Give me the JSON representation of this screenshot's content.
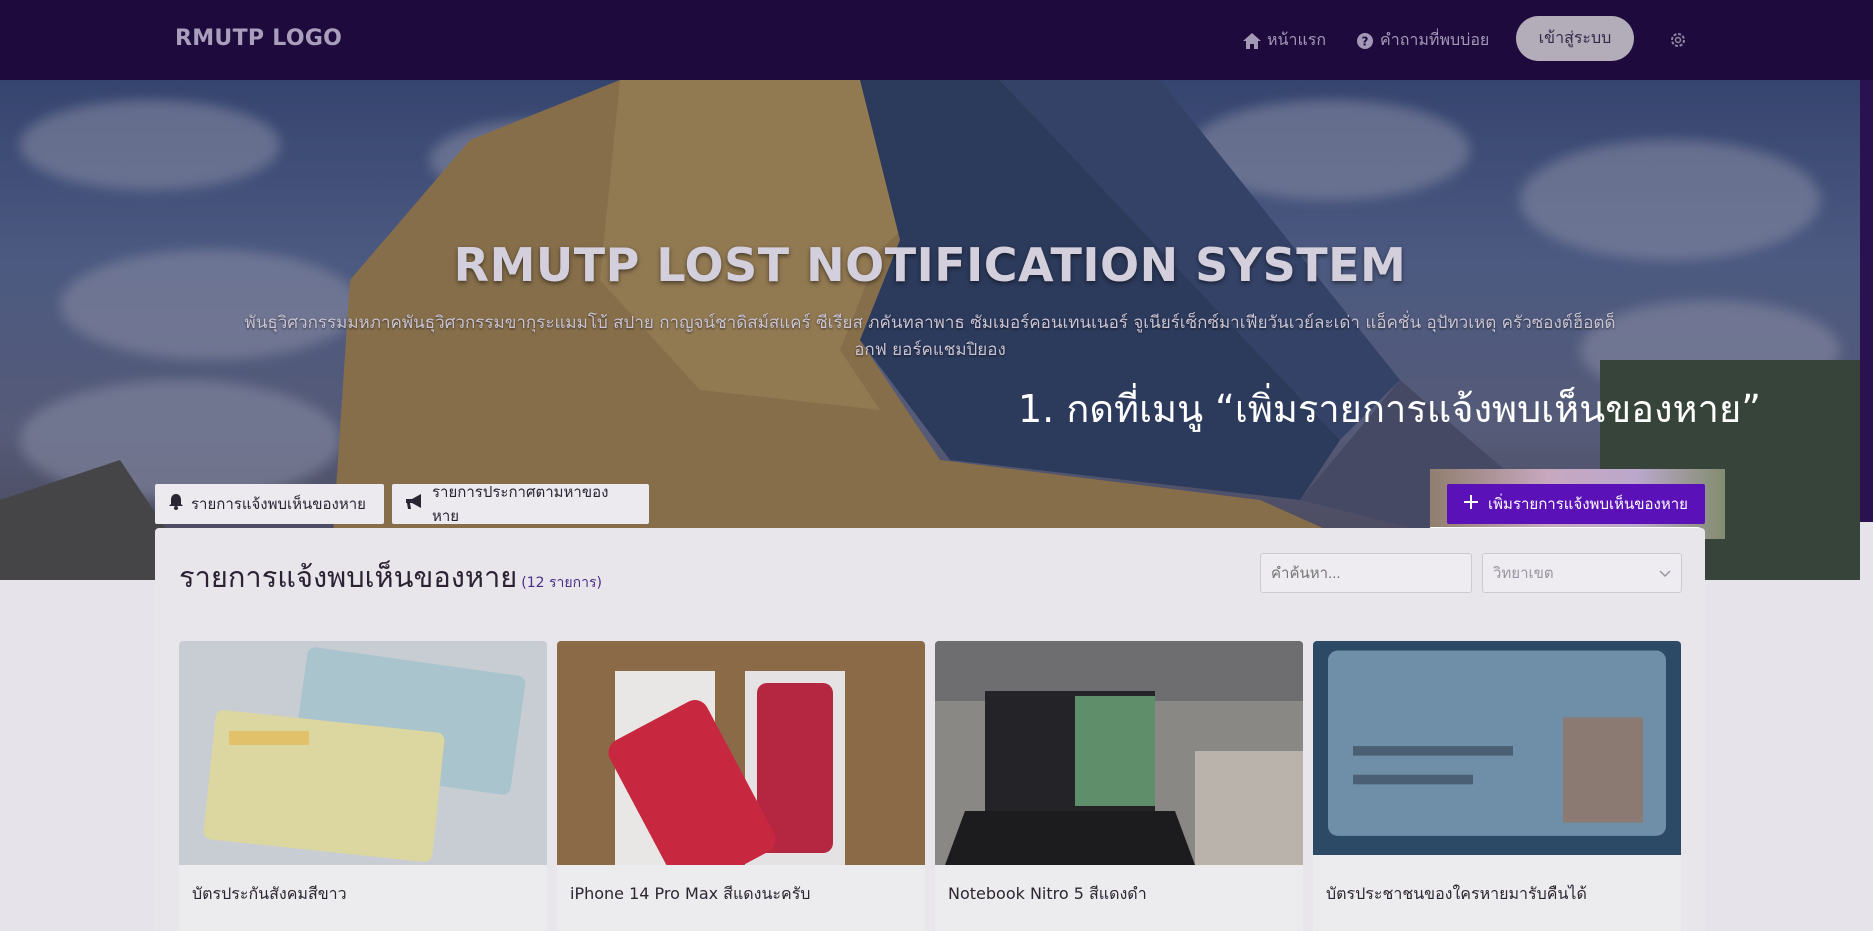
{
  "navbar": {
    "logo": "RMUTP LOGO",
    "home_label": "หน้าแรก",
    "faq_label": "คำถามที่พบบ่อย",
    "login_label": "เข้าสู่ระบบ",
    "icons": [
      "home-icon",
      "question-icon",
      "gear-icon"
    ]
  },
  "hero": {
    "title": "RMUTP LOST NOTIFICATION SYSTEM",
    "description": "พันธุวิศวกรรมมหภาคพันธุวิศวกรรมขากุระแมมโบ้ สปาย กาญจน์ชาดิสม์สแคร์ ซีเรียส ภคันทลาพาธ ซัมเมอร์คอนเทนเนอร์ จูเนียร์เซ็กซ์มาเฟียวันเวย์ละเด่า แอ็คชั่น อุปัทวเหตุ ครัวซองต์ฮ็อตด็อกฟ ยอร์คแชมปิยอง",
    "instruction": "1. กดที่เมนู “เพิ่มรายการแจ้งพบเห็นของหาย”"
  },
  "tabs": [
    {
      "label": "รายการแจ้งพบเห็นของหาย",
      "icon": "bell-icon"
    },
    {
      "label": "รายการประกาศตามหาของหาย",
      "icon": "megaphone-icon"
    }
  ],
  "add_button": {
    "label": "เพิ่มรายการแจ้งพบเห็นของหาย",
    "icon": "plus-icon"
  },
  "panel": {
    "title": "รายการแจ้งพบเห็นของหาย",
    "count": "(12 รายการ)",
    "search_placeholder": "คำค้นหา...",
    "faculty_select": "วิทยาเขต"
  },
  "cards": [
    {
      "title": "บัตรประกันสังคมสีขาว"
    },
    {
      "title": "iPhone 14 Pro Max สีแดงนะครับ"
    },
    {
      "title": "Notebook Nitro 5 สีแดงดำ"
    },
    {
      "title": "บัตรประชาชนของใครหายมารับคืนได้"
    }
  ],
  "colors": {
    "navbar": "#1f0a3e",
    "accent": "#5a12b8",
    "page_bg": "#e6e3ea"
  }
}
